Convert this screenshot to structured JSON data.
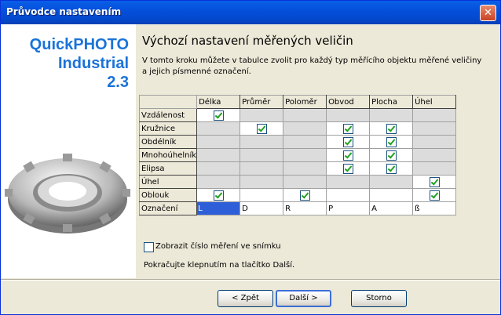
{
  "window": {
    "title": "Průvodce nastavením",
    "close_glyph": "✕"
  },
  "brand": {
    "line1": "QuickPHOTO",
    "line2": "Industrial",
    "line3": "2.3"
  },
  "page": {
    "heading": "Výchozí nastavení měřených veličin",
    "description": "V tomto kroku můžete v tabulce zvolit pro každý typ měřícího objektu měřené veličiny a jejich písmenné označení."
  },
  "table": {
    "columns": [
      "Délka",
      "Průměr",
      "Poloměr",
      "Obvod",
      "Plocha",
      "Úhel"
    ],
    "rows": [
      {
        "label": "Vzdálenost",
        "cells": [
          "check",
          "na",
          "na",
          "na",
          "na",
          "na"
        ]
      },
      {
        "label": "Kružnice",
        "cells": [
          "na",
          "check",
          "na",
          "check",
          "check",
          "na"
        ]
      },
      {
        "label": "Obdélník",
        "cells": [
          "na",
          "na",
          "na",
          "check",
          "check",
          "na"
        ]
      },
      {
        "label": "Mnohoúhelník",
        "cells": [
          "na",
          "na",
          "na",
          "check",
          "check",
          "na"
        ]
      },
      {
        "label": "Elipsa",
        "cells": [
          "na",
          "na",
          "na",
          "check",
          "check",
          "na"
        ]
      },
      {
        "label": "Úhel",
        "cells": [
          "na",
          "na",
          "na",
          "na",
          "na",
          "check"
        ]
      },
      {
        "label": "Oblouk",
        "cells": [
          "check",
          "empty",
          "check",
          "empty",
          "empty",
          "check"
        ]
      }
    ],
    "designation_label": "Označení",
    "designations": [
      "L",
      "D",
      "R",
      "P",
      "A",
      "ß"
    ]
  },
  "options": {
    "show_number_label": "Zobrazit číslo měření ve snímku",
    "show_number_checked": false
  },
  "hint": "Pokračujte klepnutím na tlačítko Další.",
  "buttons": {
    "back": "< Zpět",
    "next": "Další >",
    "cancel": "Storno"
  },
  "icons": {
    "gear": "gear-icon",
    "check": "checkmark-icon"
  }
}
